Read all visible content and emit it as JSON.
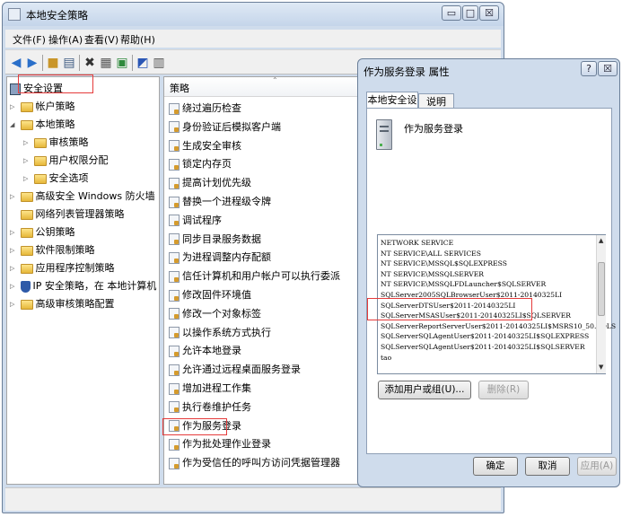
{
  "main_window": {
    "title": "本地安全策略",
    "buttons": {
      "minimize": "▭",
      "maximize": "□",
      "close": "☒"
    }
  },
  "menu": [
    "文件(F)",
    "操作(A)",
    "查看(V)",
    "帮助(H)"
  ],
  "tree": {
    "root": "安全设置",
    "items": [
      {
        "label": "帐户策略",
        "level": 1,
        "expander": "▷"
      },
      {
        "label": "本地策略",
        "level": 1,
        "expander": "◢"
      },
      {
        "label": "审核策略",
        "level": 2,
        "expander": "▷"
      },
      {
        "label": "用户权限分配",
        "level": 2,
        "expander": "▷"
      },
      {
        "label": "安全选项",
        "level": 2,
        "expander": "▷"
      },
      {
        "label": "高级安全 Windows 防火墙",
        "level": 1,
        "expander": "▷"
      },
      {
        "label": "网络列表管理器策略",
        "level": 1,
        "expander": ""
      },
      {
        "label": "公钥策略",
        "level": 1,
        "expander": "▷"
      },
      {
        "label": "软件限制策略",
        "level": 1,
        "expander": "▷"
      },
      {
        "label": "应用程序控制策略",
        "level": 1,
        "expander": "▷"
      },
      {
        "label": "IP 安全策略，在 本地计算机",
        "level": 1,
        "expander": "▷"
      },
      {
        "label": "高级审核策略配置",
        "level": 1,
        "expander": "▷"
      }
    ]
  },
  "list": {
    "header": "策略",
    "items": [
      "绕过遍历检查",
      "身份验证后模拟客户端",
      "生成安全审核",
      "锁定内存页",
      "提高计划优先级",
      "替换一个进程级令牌",
      "调试程序",
      "同步目录服务数据",
      "为进程调整内存配额",
      "信任计算机和用户帐户可以执行委派",
      "修改固件环境值",
      "修改一个对象标签",
      "以操作系统方式执行",
      "允许本地登录",
      "允许通过远程桌面服务登录",
      "增加进程工作集",
      "执行卷维护任务",
      "作为服务登录",
      "作为批处理作业登录",
      "作为受信任的呼叫方访问凭据管理器"
    ]
  },
  "dialog": {
    "title": "作为服务登录 属性",
    "help_button": "?",
    "close_button": "☒",
    "tabs": [
      "本地安全设置",
      "说明"
    ],
    "policy_name": "作为服务登录",
    "principals": [
      "NETWORK SERVICE",
      "NT SERVICE\\ALL SERVICES",
      "NT SERVICE\\MSSQL$SQLEXPRESS",
      "NT SERVICE\\MSSQLSERVER",
      "NT SERVICE\\MSSQLFDLauncher$SQLSERVER",
      "SQLServer2005SQLBrowserUser$2011-20140325LI",
      "SQLServerDTSUser$2011-20140325LI",
      "SQLServerMSASUser$2011-20140325LI$SQLSERVER",
      "SQLServerReportServerUser$2011-20140325LI$MSRS10_50.SQLS",
      "SQLServerSQLAgentUser$2011-20140325LI$SQLEXPRESS",
      "SQLServerSQLAgentUser$2011-20140325LI$SQLSERVER",
      "tao"
    ],
    "add_button": "添加用户或组(U)...",
    "remove_button": "删除(R)",
    "ok_button": "确定",
    "cancel_button": "取消",
    "apply_button": "应用(A)"
  }
}
